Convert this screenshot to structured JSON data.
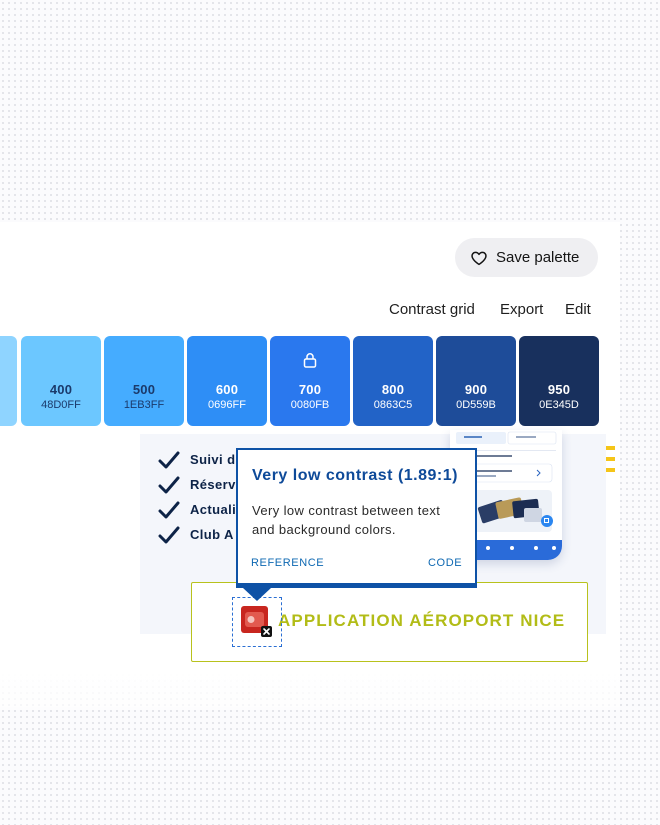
{
  "header": {
    "save_label": "Save palette",
    "save_icon": "heart-icon"
  },
  "toolbar": {
    "contrast_grid": "Contrast grid",
    "export": "Export",
    "edit": "Edit"
  },
  "palette": [
    {
      "shade": "",
      "hex": "",
      "color": "#8fd4ff",
      "text_color": "#1b3a6b",
      "locked": false
    },
    {
      "shade": "400",
      "hex": "48D0FF",
      "color": "#6cc7ff",
      "text_color": "#1b3a6b",
      "locked": false
    },
    {
      "shade": "500",
      "hex": "1EB3FF",
      "color": "#45acff",
      "text_color": "#1b3a6b",
      "locked": false
    },
    {
      "shade": "600",
      "hex": "0696FF",
      "color": "#2e8ef6",
      "text_color": "#ffffff",
      "locked": false
    },
    {
      "shade": "700",
      "hex": "0080FB",
      "color": "#2a78ee",
      "text_color": "#ffffff",
      "locked": true
    },
    {
      "shade": "800",
      "hex": "0863C5",
      "color": "#2263c7",
      "text_color": "#ffffff",
      "locked": false
    },
    {
      "shade": "900",
      "hex": "0D559B",
      "color": "#1e4c99",
      "text_color": "#ffffff",
      "locked": false
    },
    {
      "shade": "950",
      "hex": "0E345D",
      "color": "#18305d",
      "text_color": "#ffffff",
      "locked": false
    }
  ],
  "preview": {
    "checklist": [
      "Suivi d",
      "Réserv",
      "Actuali",
      "Club A"
    ],
    "app_title": "APPLICATION AÉROPORT NICE",
    "phone": {
      "tab_left": "",
      "tab_right": "",
      "card_text": "",
      "note_text": ""
    }
  },
  "tooltip": {
    "title": "Very low contrast (1.89:1)",
    "body": "Very low contrast between text and background colors.",
    "reference_label": "REFERENCE",
    "code_label": "CODE"
  },
  "colors": {
    "accent": "#0e52a6",
    "app_green": "#b2bc17",
    "check_navy": "#0d2347"
  }
}
